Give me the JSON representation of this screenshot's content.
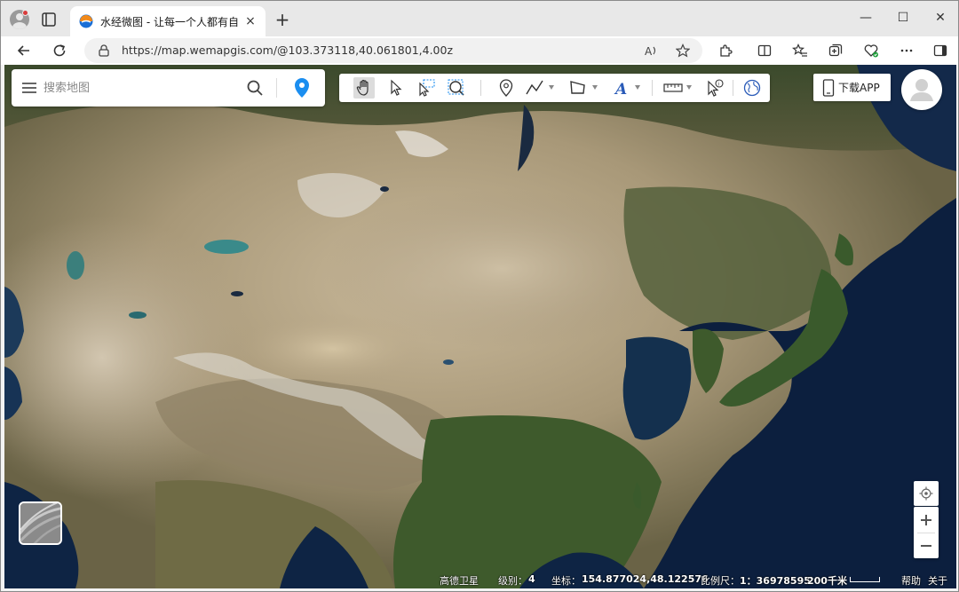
{
  "browser": {
    "tab_title": "水经微图 - 让每一个人都有自己的",
    "tab_close": "×",
    "new_tab": "+",
    "url": "https://map.wemapgis.com/@103.373118,40.061801,4.00z",
    "window_controls": {
      "minimize": "—",
      "maximize": "☐",
      "close": "✕"
    }
  },
  "search": {
    "placeholder": "搜索地图"
  },
  "toolbar": {
    "tools": [
      "pan-hand",
      "select-arrow",
      "rect-select",
      "zoom-box",
      "marker",
      "polyline",
      "polygon",
      "text",
      "measure-ruler",
      "info-pointer",
      "globe"
    ]
  },
  "header": {
    "download_label": "下载APP"
  },
  "status": {
    "layer_label": "高德卫星",
    "level_label": "级别：",
    "level_value": "4",
    "coord_label": "坐标：",
    "coord_value": "154.877024,48.122576",
    "scale_label": "比例尺：",
    "scale_value": "1：36978595",
    "scale_distance": "200千米",
    "help_link": "帮助",
    "about_link": "关于"
  },
  "colors": {
    "accent_blue": "#1b8ef0",
    "ocean": "#0c1f3e",
    "desert": "#b9a98a",
    "forest": "#3f5a2e"
  }
}
